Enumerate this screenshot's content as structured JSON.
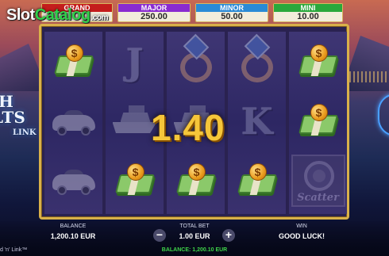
{
  "watermark": {
    "brand_main": "Slot",
    "brand_accent": "Catalog",
    "brand_suffix": ".com"
  },
  "side_logo": {
    "line1": "H",
    "line2": "LTS",
    "line3": "LINK"
  },
  "jackpots": [
    {
      "title": "GRAND",
      "value": ""
    },
    {
      "title": "MAJOR",
      "value": "250.00"
    },
    {
      "title": "MINOR",
      "value": "50.00"
    },
    {
      "title": "MINI",
      "value": "10.00"
    }
  ],
  "reels": [
    [
      "cash",
      "car",
      "car"
    ],
    [
      "J",
      "yacht",
      "cash"
    ],
    [
      "ring",
      "yacht",
      "cash"
    ],
    [
      "ring",
      "K",
      "cash"
    ],
    [
      "cash",
      "cash",
      "scatter"
    ]
  ],
  "symbols": {
    "coin_mark": "$",
    "letter_j": "J",
    "letter_k": "K",
    "scatter_label": "Scatter"
  },
  "win_amount": "1.40",
  "bottom_bar": {
    "balance_label": "BALANCE",
    "balance_value": "1,200.10 EUR",
    "total_bet_label": "TOTAL BET",
    "total_bet_value": "1.00 EUR",
    "win_label": "WIN",
    "win_value": "GOOD LUCK!",
    "minus": "−",
    "plus": "+",
    "footer_balance": "BALANCE: 1,200.10 EUR",
    "footer_brand": "d 'n' Link™"
  },
  "colors": {
    "frame_gold": "#d9b14a",
    "win_gold": "#f5c63a",
    "grand": "#c41c1c",
    "major": "#8a2bd0",
    "minor": "#2a8ad6",
    "mini": "#2aa83c"
  }
}
